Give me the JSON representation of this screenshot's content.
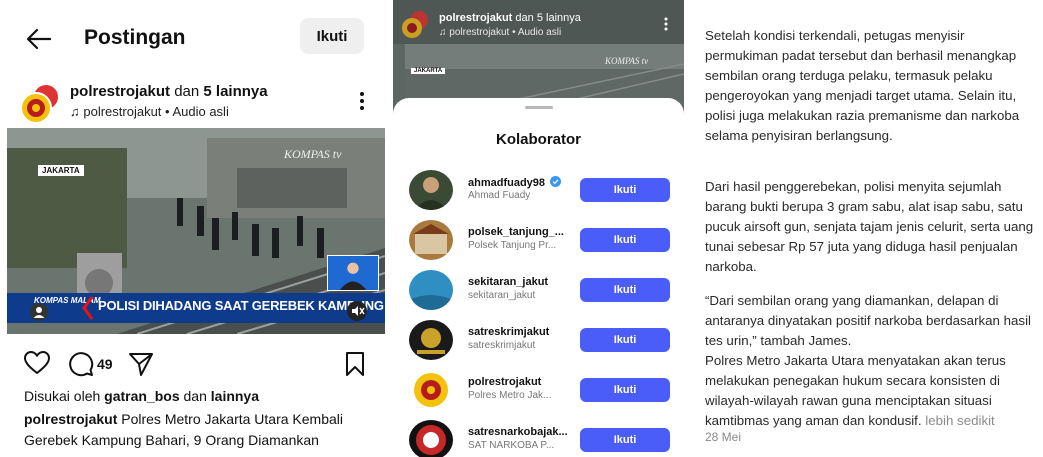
{
  "post": {
    "header": {
      "title": "Postingan",
      "follow_label": "Ikuti"
    },
    "account": {
      "username": "polrestrojakut",
      "collab_prefix": "dan",
      "collab_count": "5 lainnya",
      "audio": "polrestrojakut • Audio asli"
    },
    "video": {
      "location_tag": "JAKARTA",
      "watermark": "KOMPAS tv",
      "ticker_brand": "KOMPAS MALAM",
      "ticker_text": "POLISI DIHADANG SAAT GEREBEK KAMPUNG BAHARI"
    },
    "actions": {
      "comment_count": "49"
    },
    "liked": {
      "prefix": "Disukai oleh",
      "user": "gatran_bos",
      "joiner": "dan",
      "others": "lainnya"
    },
    "caption": {
      "user": "polrestrojakut",
      "text": "Polres Metro Jakarta Utara Kembali Gerebek Kampung Bahari, 9 Orang Diamankan"
    }
  },
  "collab_panel": {
    "top_account": "polrestrojakut",
    "top_suffix": "dan 5 lainnya",
    "top_audio": "polrestrojakut • Audio asli",
    "loc_tag": "JAKARTA",
    "watermark": "KOMPAS tv",
    "sheet_title": "Kolaborator",
    "button_label": "Ikuti",
    "items": [
      {
        "username": "ahmadfuady98",
        "name": "Ahmad Fuady",
        "verified": true
      },
      {
        "username": "polsek_tanjung_...",
        "name": "Polsek Tanjung Pr...",
        "verified": false
      },
      {
        "username": "sekitaran_jakut",
        "name": "sekitaran_jakut",
        "verified": false
      },
      {
        "username": "satreskrimjakut",
        "name": "satreskrimjakut",
        "verified": false
      },
      {
        "username": "polrestrojakut",
        "name": "Polres Metro Jak...",
        "verified": false
      },
      {
        "username": "satresnarkobajak...",
        "name": "SAT NARKOBA P...",
        "verified": false
      }
    ]
  },
  "article": {
    "paragraphs": [
      "Setelah kondisi terkendali, petugas menyisir permukiman padat tersebut dan berhasil menangkap sembilan orang terduga pelaku, termasuk pelaku pengeroyokan yang menjadi target utama. Selain itu, polisi juga melakukan razia premanisme dan narkoba selama penyisiran berlangsung.",
      "Dari hasil penggerebekan, polisi menyita sejumlah barang bukti berupa 3 gram sabu, alat isap sabu, satu pucuk airsoft gun, senjata tajam jenis celurit, serta uang tunai sebesar Rp 57 juta yang diduga hasil penjualan narkoba.",
      "“Dari sembilan orang yang diamankan, delapan di antaranya dinyatakan positif narkoba berdasarkan hasil tes urin,” tambah James.",
      "Polres Metro Jakarta Utara menyatakan akan terus melakukan penegakan hukum secara konsisten di wilayah-wilayah rawan guna menciptakan situasi kamtibmas yang aman dan kondusif."
    ],
    "more_link": "lebih sedikit",
    "date": "28 Mei"
  },
  "colors": {
    "accent": "#4a5df9",
    "ticker": "#0e3b8c"
  }
}
